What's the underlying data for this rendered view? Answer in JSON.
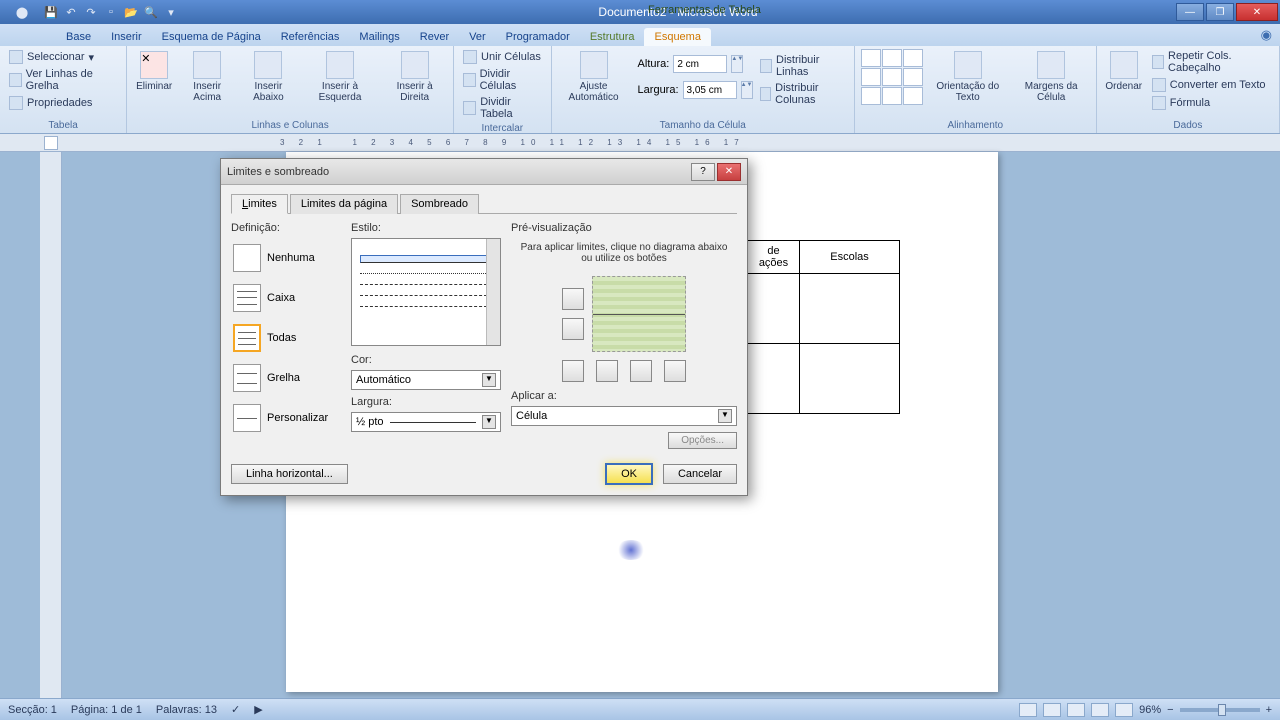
{
  "titlebar": {
    "doc_title": "Documento2 - Microsoft Word",
    "table_tools": "Ferramentas de Tabela"
  },
  "tabs": {
    "base": "Base",
    "inserir": "Inserir",
    "esquema_pagina": "Esquema de Página",
    "referencias": "Referências",
    "mailings": "Mailings",
    "rever": "Rever",
    "ver": "Ver",
    "programador": "Programador",
    "estrutura": "Estrutura",
    "esquema": "Esquema"
  },
  "ribbon": {
    "tabela": {
      "seleccionar": "Seleccionar",
      "ver_linhas": "Ver Linhas de Grelha",
      "propriedades": "Propriedades",
      "label": "Tabela"
    },
    "linhas_colunas": {
      "eliminar": "Eliminar",
      "inserir_acima": "Inserir Acima",
      "inserir_abaixo": "Inserir Abaixo",
      "inserir_esquerda": "Inserir à Esquerda",
      "inserir_direita": "Inserir à Direita",
      "label": "Linhas e Colunas"
    },
    "intercalar": {
      "unir": "Unir Células",
      "dividir_cel": "Dividir Células",
      "dividir_tab": "Dividir Tabela",
      "label": "Intercalar"
    },
    "tamanho": {
      "ajuste": "Ajuste Automático",
      "altura_lbl": "Altura:",
      "altura_val": "2 cm",
      "largura_lbl": "Largura:",
      "largura_val": "3,05 cm",
      "distribuir_linhas": "Distribuir Linhas",
      "distribuir_colunas": "Distribuir Colunas",
      "label": "Tamanho da Célula"
    },
    "alinhamento": {
      "orientacao": "Orientação do Texto",
      "margens": "Margens da Célula",
      "label": "Alinhamento"
    },
    "dados": {
      "ordenar": "Ordenar",
      "repetir": "Repetir Cols. Cabeçalho",
      "converter": "Converter em Texto",
      "formula": "Fórmula",
      "label": "Dados"
    }
  },
  "page_table": {
    "c1": "de",
    "c2": "ações",
    "c3": "Escolas"
  },
  "dialog": {
    "title": "Limites e sombreado",
    "tab_limites": "Limites",
    "tab_limites_pagina": "Limites da página",
    "tab_sombreado": "Sombreado",
    "definicao": "Definição:",
    "opt_nenhuma": "Nenhuma",
    "opt_caixa": "Caixa",
    "opt_todas": "Todas",
    "opt_grelha": "Grelha",
    "opt_personalizar": "Personalizar",
    "estilo": "Estilo:",
    "cor": "Cor:",
    "cor_auto": "Automático",
    "largura_lbl": "Largura:",
    "largura_val": "½ pto",
    "previs": "Pré-visualização",
    "previs_text": "Para aplicar limites, clique no diagrama abaixo ou utilize os botões",
    "aplicar_a": "Aplicar a:",
    "aplicar_val": "Célula",
    "opcoes": "Opções...",
    "linha_h": "Linha horizontal...",
    "ok": "OK",
    "cancelar": "Cancelar"
  },
  "statusbar": {
    "seccao": "Secção: 1",
    "pagina": "Página: 1 de 1",
    "palavras": "Palavras: 13",
    "zoom": "96%"
  }
}
